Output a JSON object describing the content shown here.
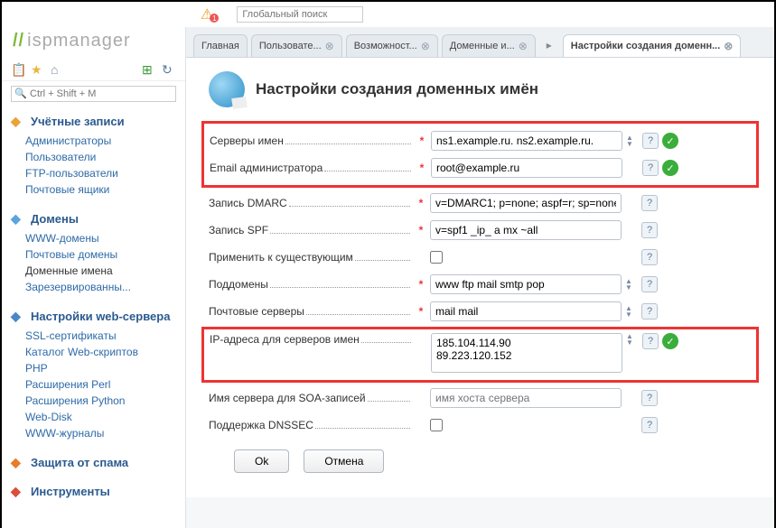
{
  "globalSearch": {
    "placeholder": "Глобальный поиск"
  },
  "logo": "ispmanager",
  "shortcut": {
    "placeholder": "Ctrl + Shift + M"
  },
  "sidebar": {
    "groups": [
      {
        "title": "Учётные записи",
        "iconColor": "#e9a33b",
        "items": [
          "Администраторы",
          "Пользователи",
          "FTP-пользователи",
          "Почтовые ящики"
        ],
        "active": -1
      },
      {
        "title": "Домены",
        "iconColor": "#5aa4e0",
        "items": [
          "WWW-домены",
          "Почтовые домены",
          "Доменные имена",
          "Зарезервированны..."
        ],
        "active": 2
      },
      {
        "title": "Настройки web-сервера",
        "iconColor": "#4a88c8",
        "items": [
          "SSL-сертификаты",
          "Каталог Web-скриптов",
          "PHP",
          "Расширения Perl",
          "Расширения Python",
          "Web-Disk",
          "WWW-журналы"
        ],
        "active": -1
      },
      {
        "title": "Защита от спама",
        "iconColor": "#e77c2a",
        "items": [],
        "active": -1
      },
      {
        "title": "Инструменты",
        "iconColor": "#d94f3a",
        "items": [],
        "active": -1
      }
    ]
  },
  "tabs": [
    {
      "label": "Главная",
      "close": false
    },
    {
      "label": "Пользовате...",
      "close": true
    },
    {
      "label": "Возможност...",
      "close": true
    },
    {
      "label": "Доменные и...",
      "close": true
    },
    {
      "label": "Настройки создания доменн...",
      "close": true,
      "active": true
    }
  ],
  "form": {
    "title": "Настройки создания доменных имён",
    "rows": {
      "ns": {
        "label": "Серверы имен",
        "value": "ns1.example.ru. ns2.example.ru."
      },
      "email": {
        "label": "Email администратора",
        "value": "root@example.ru"
      },
      "dmarc": {
        "label": "Запись DMARC",
        "value": "v=DMARC1; p=none; aspf=r; sp=none"
      },
      "spf": {
        "label": "Запись SPF",
        "value": "v=spf1 _ip_ a mx ~all"
      },
      "apply": {
        "label": "Применить к существующим"
      },
      "sub": {
        "label": "Поддомены",
        "value": "www ftp mail smtp pop"
      },
      "mx": {
        "label": "Почтовые серверы",
        "value": "mail mail"
      },
      "ip": {
        "label": "IP-адреса для серверов имен",
        "value": "185.104.114.90\n89.223.120.152"
      },
      "soa": {
        "label": "Имя сервера для SOA-записей",
        "placeholder": "имя хоста сервера",
        "value": ""
      },
      "dnssec": {
        "label": "Поддержка DNSSEC"
      }
    },
    "buttons": {
      "ok": "Ok",
      "cancel": "Отмена"
    }
  }
}
